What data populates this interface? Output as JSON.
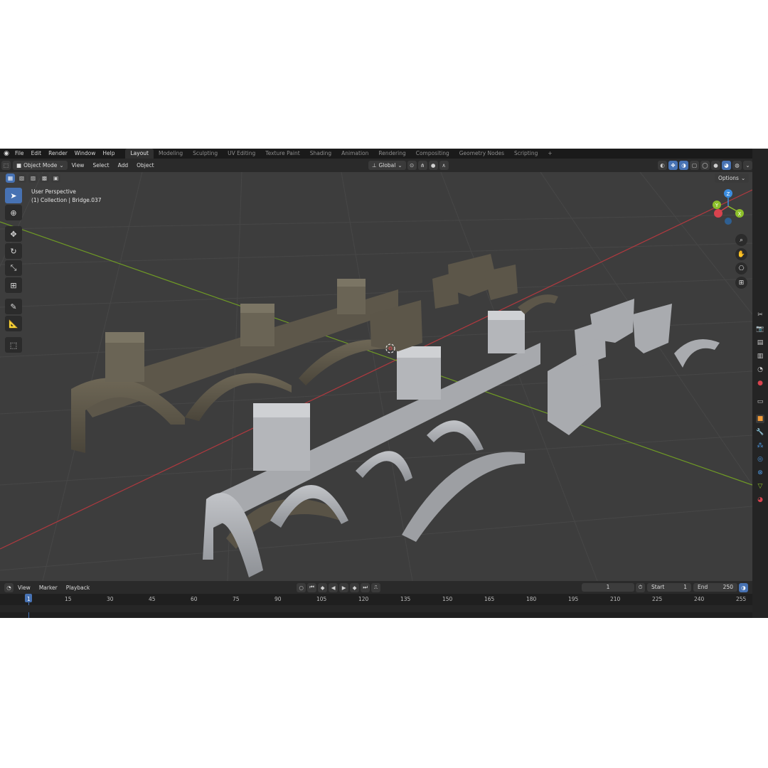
{
  "topbar": {
    "logo_icon": "blender-logo-icon",
    "menus": [
      "File",
      "Edit",
      "Render",
      "Window",
      "Help"
    ],
    "workspaces": [
      "Layout",
      "Modeling",
      "Sculpting",
      "UV Editing",
      "Texture Paint",
      "Shading",
      "Animation",
      "Rendering",
      "Compositing",
      "Geometry Nodes",
      "Scripting"
    ],
    "active_workspace": "Layout",
    "add_tab": "+"
  },
  "viewport_header": {
    "mode": "Object Mode",
    "menus": [
      "View",
      "Select",
      "Add",
      "Object"
    ],
    "orientation": "Global",
    "options": "Options"
  },
  "overlay": {
    "perspective": "User Perspective",
    "collection": "(1) Collection | Bridge.037"
  },
  "gizmo": {
    "x": "X",
    "y": "Y",
    "z": "Z"
  },
  "colors": {
    "accent": "#4772b3",
    "x_axis": "#d8434e",
    "y_axis": "#8cbf2a",
    "z_axis": "#3b8de0",
    "grid": "#4a4a4a",
    "viewport_bg": "#3d3d3d"
  },
  "toolbar_icons": [
    "select-box-icon",
    "cursor-icon",
    "move-icon",
    "rotate-icon",
    "scale-icon",
    "transform-icon",
    "annotate-icon",
    "measure-icon",
    "add-cube-icon"
  ],
  "timeline": {
    "menus": [
      "View",
      "Marker",
      "Playback"
    ],
    "current_frame": "1",
    "start_label": "Start",
    "start": "1",
    "end_label": "End",
    "end": "250",
    "ticks": [
      "1",
      "15",
      "30",
      "45",
      "60",
      "75",
      "90",
      "105",
      "120",
      "135",
      "150",
      "165",
      "180",
      "195",
      "210",
      "225",
      "240",
      "255"
    ]
  }
}
